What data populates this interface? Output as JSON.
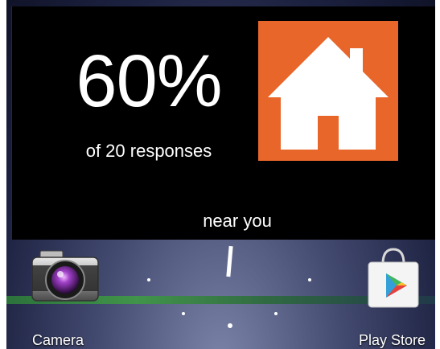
{
  "widget": {
    "stat_value": "60%",
    "stat_caption": "of 20 responses",
    "location_label": "near you",
    "tile_icon": "home-icon",
    "tile_color": "#e8662a"
  },
  "dock": {
    "apps": [
      {
        "label": "Camera",
        "icon": "camera-icon"
      },
      {
        "label": "Play Store",
        "icon": "play-store-icon"
      }
    ]
  },
  "colors": {
    "widget_background": "#000000",
    "text": "#ffffff",
    "accent_green": "#3f9a44"
  }
}
